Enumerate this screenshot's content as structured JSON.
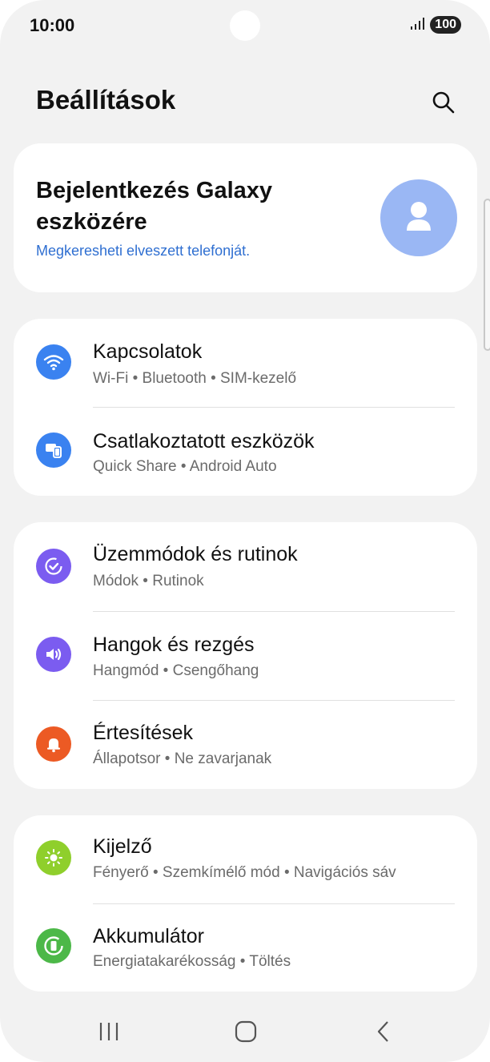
{
  "status_bar": {
    "time": "10:00",
    "battery": "100"
  },
  "header": {
    "title": "Beállítások"
  },
  "account": {
    "title": "Bejelentkezés Galaxy eszközére",
    "subtitle": "Megkeresheti elveszett telefonját."
  },
  "groups": [
    {
      "items": [
        {
          "label": "Kapcsolatok",
          "sub": "Wi-Fi  •  Bluetooth  •  SIM-kezelő",
          "icon": "wifi-icon",
          "color": "#3a82f0"
        },
        {
          "label": "Csatlakoztatott eszközök",
          "sub": "Quick Share  •  Android Auto",
          "icon": "connected-devices-icon",
          "color": "#3a82f0"
        }
      ]
    },
    {
      "items": [
        {
          "label": "Üzemmódok és rutinok",
          "sub": "Módok  •  Rutinok",
          "icon": "modes-routines-icon",
          "color": "#7b5cf0"
        },
        {
          "label": "Hangok és rezgés",
          "sub": "Hangmód  •  Csengőhang",
          "icon": "speaker-icon",
          "color": "#7b5cf0"
        },
        {
          "label": "Értesítések",
          "sub": "Állapotsor  •  Ne zavarjanak",
          "icon": "bell-icon",
          "color": "#ec5a24"
        }
      ]
    },
    {
      "items": [
        {
          "label": "Kijelző",
          "sub": "Fényerő  •  Szemkímélő mód  •  Navigációs sáv",
          "icon": "sun-icon",
          "color": "#8fcf2c"
        },
        {
          "label": "Akkumulátor",
          "sub": "Energiatakarékosság  •  Töltés",
          "icon": "battery-icon",
          "color": "#4cb848"
        }
      ]
    }
  ]
}
